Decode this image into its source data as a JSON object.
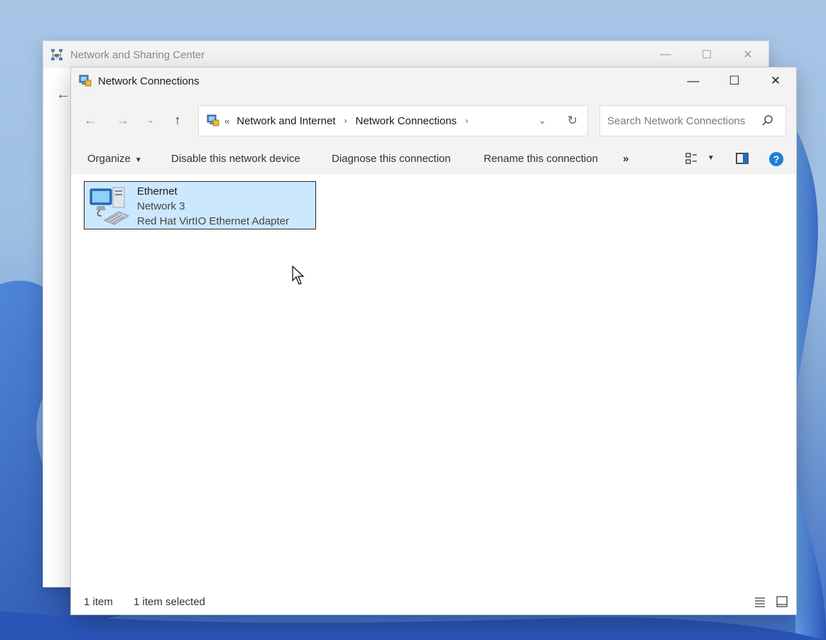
{
  "back_window": {
    "title": "Network and Sharing Center"
  },
  "window": {
    "title": "Network Connections",
    "minimize_label": "—",
    "maximize_label": "☐",
    "close_label": "✕"
  },
  "address": {
    "overflow": "«",
    "crumbs": [
      "Network and Internet",
      "Network Connections"
    ],
    "search_placeholder": "Search Network Connections"
  },
  "commands": {
    "organize": "Organize",
    "disable": "Disable this network device",
    "diagnose": "Diagnose this connection",
    "rename": "Rename this connection",
    "more": "»"
  },
  "items": [
    {
      "name": "Ethernet",
      "network": "Network 3",
      "adapter": "Red Hat VirtIO Ethernet Adapter",
      "selected": true
    }
  ],
  "status": {
    "count": "1 item",
    "selected": "1 item selected"
  },
  "colors": {
    "selection_fill": "#cce8ff",
    "help_blue": "#1f7fd8"
  }
}
